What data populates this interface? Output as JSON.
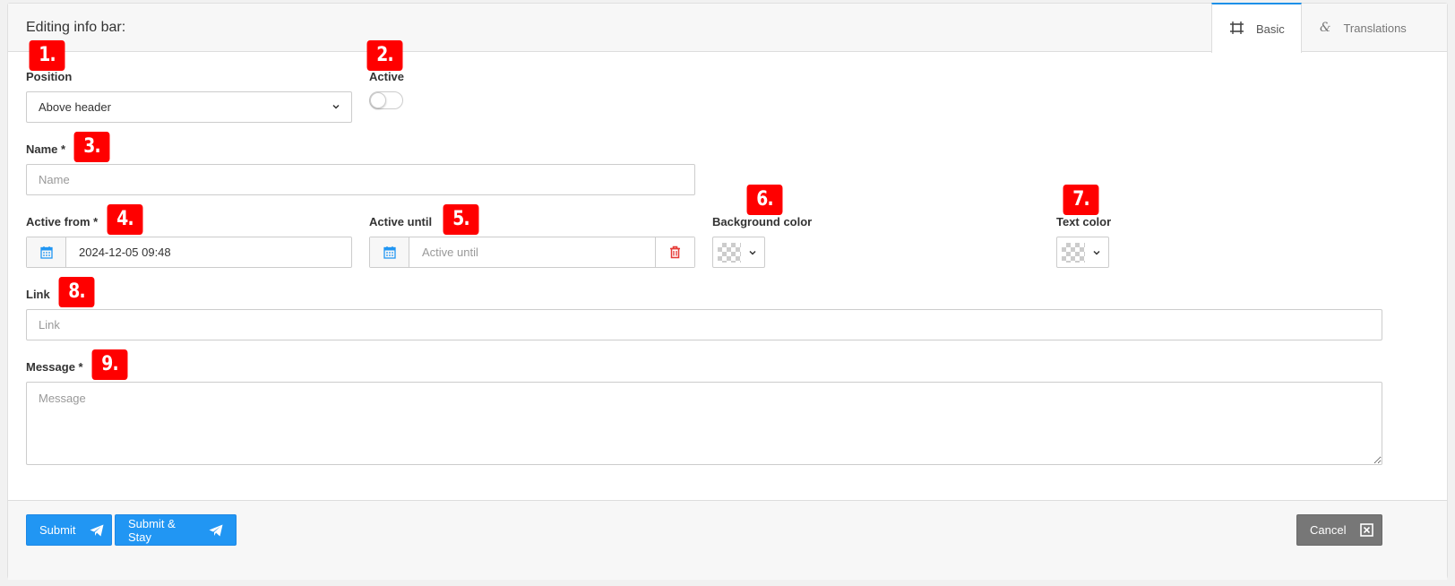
{
  "header": {
    "title": "Editing info bar:",
    "tabs": [
      {
        "label": "Basic",
        "icon": "frame-icon",
        "active": true
      },
      {
        "label": "Translations",
        "icon": "ampersand-icon",
        "active": false
      }
    ]
  },
  "badges": [
    "1.",
    "2.",
    "3.",
    "4.",
    "5.",
    "6.",
    "7.",
    "8.",
    "9."
  ],
  "form": {
    "position": {
      "label": "Position",
      "value": "Above header"
    },
    "active": {
      "label": "Active",
      "checked": false
    },
    "name": {
      "label": "Name *",
      "placeholder": "Name"
    },
    "active_from": {
      "label": "Active from *",
      "value": "2024-12-05 09:48"
    },
    "active_until": {
      "label": "Active until",
      "placeholder": "Active until"
    },
    "background_color": {
      "label": "Background color"
    },
    "text_color": {
      "label": "Text color"
    },
    "link": {
      "label": "Link",
      "placeholder": "Link"
    },
    "message": {
      "label": "Message *",
      "placeholder": "Message"
    }
  },
  "footer": {
    "submit": "Submit",
    "submit_stay": "Submit & Stay",
    "cancel": "Cancel"
  },
  "colors": {
    "accent": "#2196f3",
    "badge": "#ff0000",
    "delete": "#e53935",
    "cancel": "#777777"
  }
}
